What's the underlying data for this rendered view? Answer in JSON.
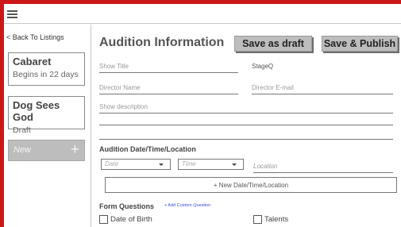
{
  "nav": {
    "menu_icon": "hamburger-icon",
    "back_label": "< Back To Listings"
  },
  "listings": [
    {
      "title": "Cabaret",
      "subtitle": "Begins in 22 days"
    },
    {
      "title": "Dog Sees God",
      "subtitle": "Draft"
    }
  ],
  "new_listing": {
    "label": "New",
    "icon": "plus-icon"
  },
  "header": {
    "title": "Audition Information",
    "save_draft_label": "Save as draft",
    "publish_label": "Save & Publish"
  },
  "form": {
    "show_title_placeholder": "Show Title",
    "company_value": "StageQ",
    "director_name_placeholder": "Director Name",
    "director_email_placeholder": "Director E-mail",
    "description_placeholder": "Show description"
  },
  "audition": {
    "section_label": "Audition Date/Time/Location",
    "date_placeholder": "Date",
    "time_placeholder": "Time",
    "location_placeholder": "Location",
    "new_slot_label": "+ New Date/Time/Location"
  },
  "questions": {
    "section_label": "Form Questions",
    "add_custom_label": "+ Add Custom Question",
    "items": [
      "Date of Birth",
      "Talents"
    ]
  },
  "colors": {
    "frame_border": "#cc1719",
    "button_bg": "#bdbdbd",
    "link": "#3b4fd6"
  }
}
